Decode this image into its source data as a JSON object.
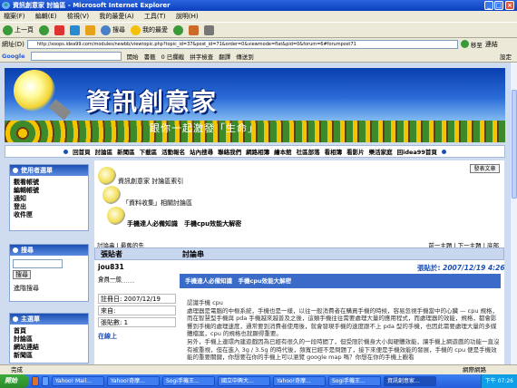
{
  "window": {
    "title": "資訊創意家 討論區 - Microsoft Internet Explorer"
  },
  "menu": [
    "檔案(F)",
    "編輯(E)",
    "檢視(V)",
    "我的最愛(A)",
    "工具(T)",
    "說明(H)"
  ],
  "toolbar": {
    "back": "上一頁",
    "search": "搜尋",
    "favorites": "我的最愛"
  },
  "address": {
    "label": "網址(D)",
    "url": "http://xoops.idea99.com/modules/newbb/viewtopic.php?topic_id=37&post_id=71&order=0&viewmode=flat&pid=0&forum=6#forumpost71",
    "go": "移至",
    "links": "連結"
  },
  "google": {
    "label": "Google",
    "start": "開始",
    "bookmarks": "書籤",
    "blocked": "0 已攔截",
    "spell": "拼字檢查",
    "translate": "翻譯",
    "send": "傳送到",
    "settings": "設定"
  },
  "banner": {
    "title": "資訊創意家",
    "subtitle": "跟你一起激發「生命」"
  },
  "nav": [
    "回首頁",
    "討論區",
    "新聞區",
    "下載區",
    "活動報名",
    "站內搜尋",
    "聯絡我們",
    "網路相簿",
    "繪本館",
    "社區部落",
    "看相簿",
    "看影片",
    "樂活家庭",
    "回idea99首頁"
  ],
  "sidebar": {
    "user_menu": {
      "title": "使用者選單",
      "items": [
        "觀看帳號",
        "編輯帳號",
        "通知",
        "登出",
        "收件匣"
      ]
    },
    "search": {
      "title": "搜尋",
      "button": "搜尋",
      "advanced": "進階搜尋"
    },
    "main_menu": {
      "title": "主選單",
      "items": [
        "首頁",
        "討論區",
        "網站連結",
        "新聞區"
      ]
    }
  },
  "forum": {
    "print_button": "發表文章",
    "breadcrumb": [
      "資訊創意家 討論區索引",
      "「資料收集」相關討論區",
      "手機達人必備知識　手機cpu效能大解密"
    ],
    "topic_bar_left": "討論串 | 最舊的先",
    "topic_bar_right": "前一主題 | 下一主題 | 底部",
    "col_author": "張貼者",
    "col_thread": "討論串",
    "author": "jou831",
    "rank": "會員一般",
    "register": "註冊日: 2007/12/19",
    "from": "來自:",
    "posts": "張貼數: 1",
    "online": "在線上",
    "post_title": "手機達人必備知識　手機cpu效能大解密",
    "post_date_label": "張貼於:",
    "post_date": "2007/12/19 4:26",
    "post_paragraphs": [
      "認識手機 cpu",
      "處理器是電腦的中樞系統，手機也是一樣，以往一般消費者在購買手機的時候，容易忽視手機當中的心臟 — cpu 規格，而在智慧型手機與 pda 手機越來越普及之後，這類手機往往需要處理大量的應用程式，而處理器的效能，規格，都會影響到手機的處理速度，通常要到消費者使用後，就會發現手機的速度跟不上 pda 型的手機，也因此需要處理大量的多媒體檔案，cpu 的規格也就顯得重要。",
      "另外，手機上連環內建遊戲因為已經有很久的一段時間了，但受限於機身大小與硬體效能，讓手機上網遊戲的功能一直沒有被重視，但在進入 3g / 3.5g 的時代後，頻寬已經不是問題了，接下來便是手機效能的發展，手機的 cpu 便是手機效能的重要關鍵，你想要在你的手機上可以瀏覽 google map 嗎？你想在你的手機上觀看"
    ]
  },
  "status": {
    "text": "完成",
    "zone": "網際網路"
  },
  "taskbar": {
    "start": "開始",
    "tasks": [
      "Yahoo! Mail...",
      "Yahoo!奇摩...",
      "Sogi手機王...",
      "國立中興大...",
      "Yahoo!奇摩...",
      "Sogi手機王...",
      "資訊創意家..."
    ],
    "clock": "下午 07:26"
  }
}
